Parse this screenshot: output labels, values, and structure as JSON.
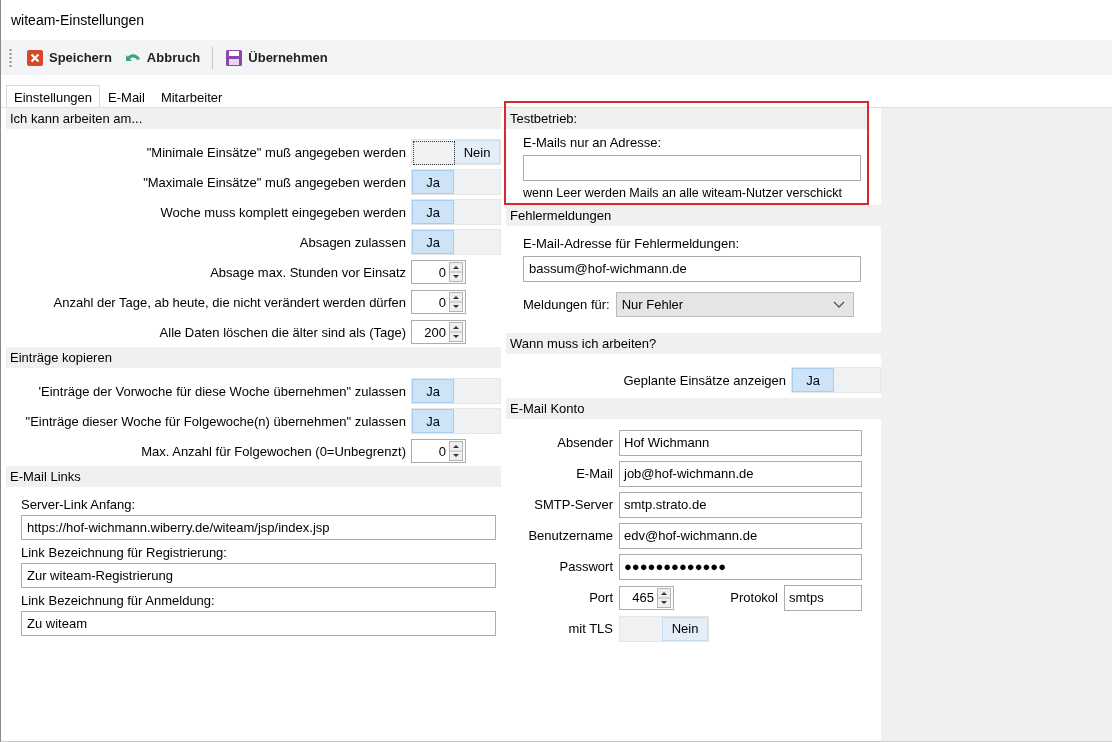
{
  "window": {
    "title": "witeam-Einstellungen"
  },
  "toolbar": [
    {
      "kind": "button",
      "label": "Speichern"
    },
    {
      "kind": "button",
      "label": "Abbruch"
    },
    {
      "kind": "separator"
    },
    {
      "kind": "button",
      "label": "Übernehmen"
    }
  ],
  "tabs": [
    {
      "label": "Einstellungen",
      "selected": true
    },
    {
      "label": "E-Mail",
      "selected": false
    },
    {
      "label": "Mitarbeiter",
      "selected": false
    }
  ],
  "left_sections": [
    {
      "title": "Ich kann arbeiten am...",
      "highlighted": false,
      "rows": [
        {
          "kind": "toggle",
          "label": "\"Minimale Einsätze\" muß angegeben werden",
          "on": false,
          "focused": true,
          "text": "Nein"
        },
        {
          "kind": "toggle",
          "label": "\"Maximale Einsätze\" muß angegeben werden",
          "on": true,
          "focused": false,
          "text": "Ja"
        },
        {
          "kind": "toggle",
          "label": "Woche muss komplett eingegeben werden",
          "on": true,
          "focused": false,
          "text": "Ja"
        },
        {
          "kind": "toggle",
          "label": "Absagen zulassen",
          "on": true,
          "focused": false,
          "text": "Ja"
        },
        {
          "kind": "spin",
          "label": "Absage max. Stunden vor Einsatz",
          "value": "0"
        },
        {
          "kind": "spin",
          "label": "Anzahl der Tage, ab heute, die nicht verändert werden dürfen",
          "value": "0"
        },
        {
          "kind": "spin",
          "label": "Alle Daten löschen die älter sind als (Tage)",
          "value": "200"
        }
      ]
    },
    {
      "title": "Einträge kopieren",
      "highlighted": false,
      "rows": [
        {
          "kind": "toggle",
          "label": "'Einträge der Vorwoche für diese Woche übernehmen\" zulassen",
          "on": true,
          "focused": false,
          "text": "Ja"
        },
        {
          "kind": "toggle",
          "label": "\"Einträge dieser Woche für Folgewoche(n) übernehmen\" zulassen",
          "on": true,
          "focused": false,
          "text": "Ja"
        },
        {
          "kind": "spin",
          "label": "Max. Anzahl für Folgewochen (0=Unbegrenzt)",
          "value": "0"
        }
      ]
    },
    {
      "title": "E-Mail Links",
      "highlighted": false,
      "rows": [
        {
          "kind": "caption",
          "text": "Server-Link Anfang:"
        },
        {
          "kind": "field",
          "value": "https://hof-wichmann.wiberry.de/witeam/jsp/index.jsp"
        },
        {
          "kind": "caption",
          "text": "Link Bezeichnung für Registrierung:"
        },
        {
          "kind": "field",
          "value": "Zur witeam-Registrierung"
        },
        {
          "kind": "caption",
          "text": "Link Bezeichnung für Anmeldung:"
        },
        {
          "kind": "field",
          "value": "Zu witeam"
        }
      ]
    }
  ],
  "right_sections": [
    {
      "title": "Testbetrieb:",
      "highlighted": true,
      "rows": [
        {
          "kind": "caption",
          "text": "E-Mails nur an Adresse:"
        },
        {
          "kind": "field",
          "value": ""
        },
        {
          "kind": "hint",
          "text": "wenn Leer werden Mails an alle witeam-Nutzer verschickt"
        }
      ]
    },
    {
      "title": "Fehlermeldungen",
      "highlighted": false,
      "rows": [
        {
          "kind": "caption",
          "text": "E-Mail-Adresse für Fehlermeldungen:"
        },
        {
          "kind": "field",
          "value": "bassum@hof-wichmann.de"
        },
        {
          "kind": "select",
          "label": "Meldungen für:",
          "value": "Nur Fehler"
        }
      ]
    },
    {
      "title": "Wann muss ich arbeiten?",
      "highlighted": false,
      "rows": [
        {
          "kind": "toggle",
          "label": "Geplante Einsätze anzeigen",
          "on": true,
          "focused": false,
          "text": "Ja"
        }
      ]
    },
    {
      "title": "E-Mail Konto",
      "highlighted": false,
      "rows": [
        {
          "kind": "form",
          "label": "Absender",
          "value": "Hof Wichmann"
        },
        {
          "kind": "form",
          "label": "E-Mail",
          "value": "job@hof-wichmann.de"
        },
        {
          "kind": "form",
          "label": "SMTP-Server",
          "value": "smtp.strato.de"
        },
        {
          "kind": "form",
          "label": "Benutzername",
          "value": "edv@hof-wichmann.de"
        },
        {
          "kind": "form",
          "label": "Passwort",
          "value": "●●●●●●●●●●●●●"
        },
        {
          "kind": "port",
          "label": "Port",
          "value": "465",
          "label2": "Protokol",
          "value2": "smtps"
        },
        {
          "kind": "form_toggle",
          "label": "mit TLS",
          "on": false,
          "focused": false,
          "text": "Nein"
        }
      ]
    }
  ]
}
